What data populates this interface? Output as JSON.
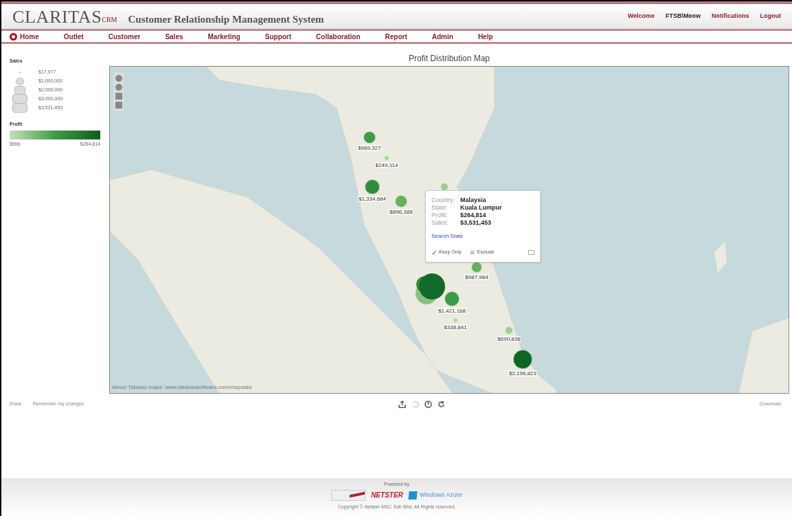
{
  "header": {
    "logo": "CLARITAS",
    "logo_suffix": "CRM",
    "title": "Customer Relationship Management System",
    "welcome": "Welcome",
    "user": "FTSB\\Meow",
    "links": [
      "Notifications",
      "Logout"
    ]
  },
  "nav": [
    {
      "label": "Home"
    },
    {
      "label": "Outlet"
    },
    {
      "label": "Customer"
    },
    {
      "label": "Sales"
    },
    {
      "label": "Marketing"
    },
    {
      "label": "Support"
    },
    {
      "label": "Collaboration"
    },
    {
      "label": "Report"
    },
    {
      "label": "Admin"
    },
    {
      "label": "Help"
    }
  ],
  "legend": {
    "sales_title": "Sales",
    "sales": [
      "$17,977",
      "$1,000,000",
      "$2,000,000",
      "$3,000,000",
      "$3,531,453"
    ],
    "profit_title": "Profit",
    "profit_min": "$596",
    "profit_max": "$264,814"
  },
  "map": {
    "title": "Profit Distribution Map",
    "attribution": "About Tableau maps: www.tableausoftware.com/mapdata",
    "markers": [
      {
        "label": "$969,327",
        "color": "#3f9a45"
      },
      {
        "label": "$249,114",
        "color": "#a8d59a"
      },
      {
        "label": "$1,334,684",
        "color": "#2e8b3a"
      },
      {
        "label": "$896,388",
        "color": "#66b060"
      },
      {
        "color": "#9ccf8f"
      },
      {
        "kind": "cluster",
        "circles": [
          {
            "color": "#8cc083"
          },
          {
            "color": "#2f8a3c"
          },
          {
            "color": "#136b2a"
          }
        ]
      },
      {
        "label": "$987,984",
        "color": "#66af5e"
      },
      {
        "label": "$1,421,168",
        "color": "#3d9a45"
      },
      {
        "label": "$338,841",
        "color": "#b0d9a3"
      },
      {
        "label": "$690,836",
        "color": "#9ccf8f"
      },
      {
        "label": "$2,196,823",
        "color": "#0e6624"
      }
    ],
    "tooltip": {
      "rows": [
        {
          "key": "Country:",
          "value": "Malaysia"
        },
        {
          "key": "State:",
          "value": "Kuala Lumpur"
        },
        {
          "key": "Profit:",
          "value": "$264,814"
        },
        {
          "key": "Sales:",
          "value": "$3,531,453"
        }
      ],
      "link": "Search State",
      "actions": [
        "Keep Only",
        "Exclude"
      ]
    }
  },
  "toolbar": {
    "share": "Share",
    "remember": "Remember my changes",
    "download": "Download"
  },
  "footer": {
    "powered_by": "Powered by",
    "partner": "NETSTER",
    "azure": "Windows Azure",
    "copyright": "Copyright © Netster MSC Sdn Bhd. All Rights reserved."
  }
}
